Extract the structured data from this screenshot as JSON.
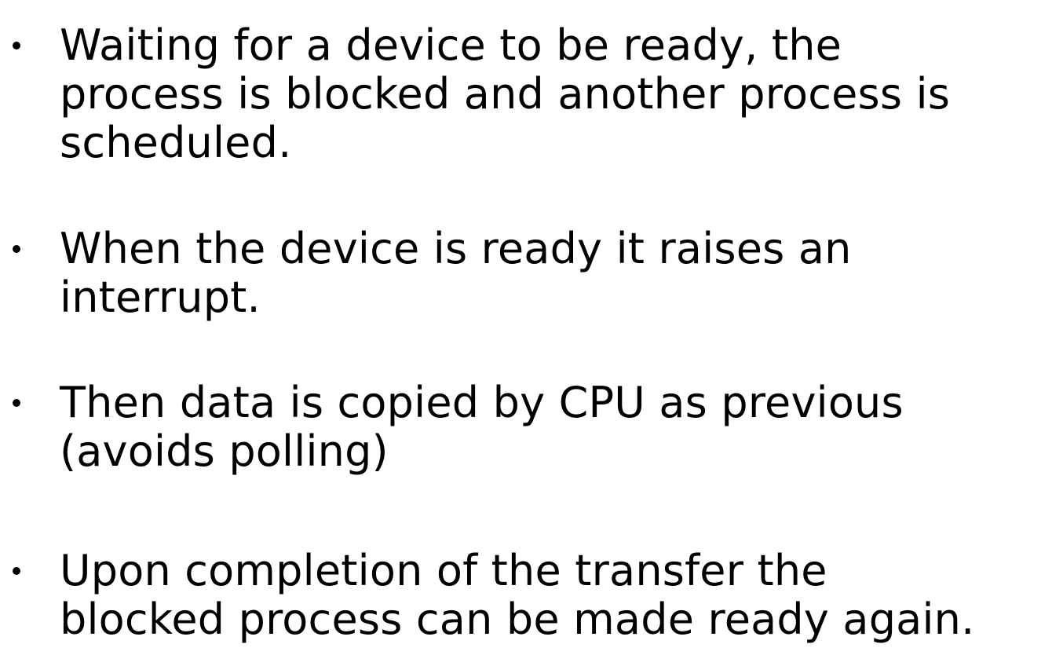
{
  "bullets": [
    {
      "lines": [
        "Waiting for a device to be ready, the",
        "process is blocked and another process is",
        "scheduled."
      ]
    },
    {
      "lines": [
        "When the device is ready it raises an",
        "interrupt."
      ]
    },
    {
      "lines": [
        "Then data is copied by CPU as previous",
        "(avoids polling)"
      ]
    },
    {
      "lines": [
        "Upon completion of the transfer the",
        "blocked process can be made ready again."
      ]
    }
  ]
}
